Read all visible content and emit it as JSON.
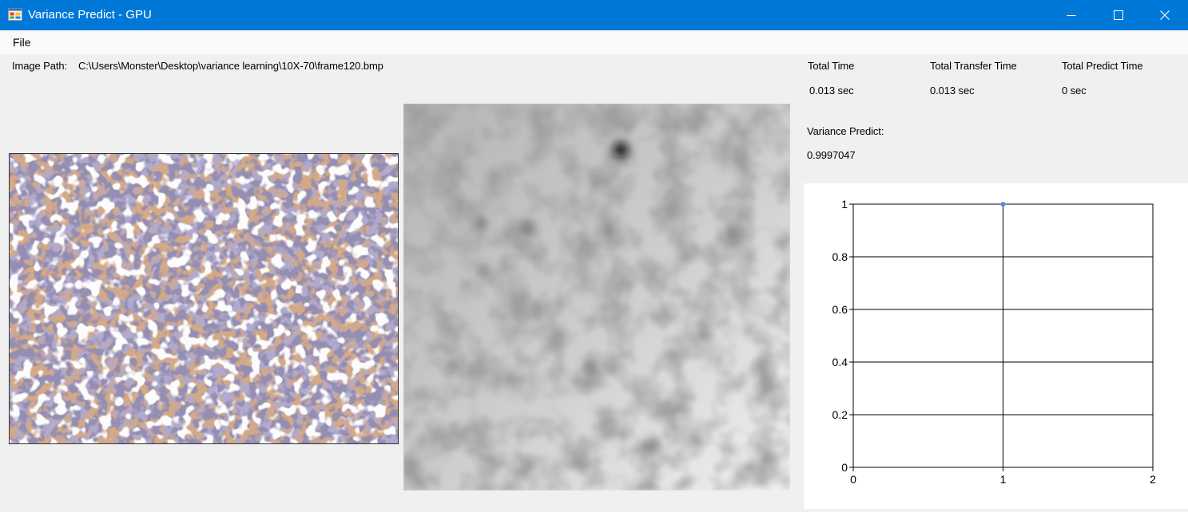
{
  "window": {
    "title": "Variance Predict - GPU",
    "title_bar_color": "#0078d7",
    "controls": [
      "minimize-icon",
      "maximize-icon",
      "close-icon"
    ]
  },
  "menu": {
    "items": [
      {
        "label": "File"
      }
    ]
  },
  "image_path": {
    "label": "Image Path:",
    "value": "C:\\Users\\Monster\\Desktop\\variance learning\\10X-70\\frame120.bmp"
  },
  "stats": {
    "total_time": {
      "label": "Total Time",
      "value": "0.013 sec"
    },
    "total_transfer_time": {
      "label": "Total Transfer Time",
      "value": "0.013 sec"
    },
    "total_predict_time": {
      "label": "Total Predict Time",
      "value": "0 sec"
    }
  },
  "variance_predict": {
    "label": "Variance Predict:",
    "value": "0.9997047"
  },
  "chart_data": {
    "type": "scatter",
    "title": "",
    "xlabel": "",
    "ylabel": "",
    "xlim": [
      0,
      2
    ],
    "ylim": [
      0,
      1
    ],
    "x_ticks": [
      "0",
      "1",
      "2"
    ],
    "y_ticks": [
      "0",
      "0.2",
      "0.4",
      "0.6",
      "0.8",
      "1"
    ],
    "grid": true,
    "series": [
      {
        "points": [
          {
            "x": 1,
            "y": 0.9997047
          }
        ],
        "color": "#4a90d9"
      }
    ]
  }
}
